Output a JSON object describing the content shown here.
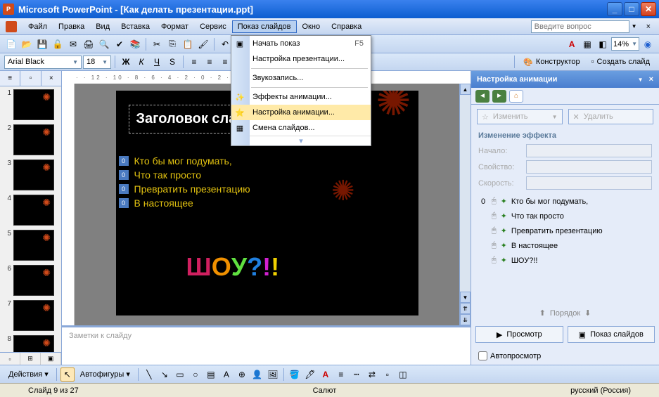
{
  "title": "Microsoft PowerPoint - [Как делать презентации.ppt]",
  "menu": {
    "file": "Файл",
    "edit": "Правка",
    "view": "Вид",
    "insert": "Вставка",
    "format": "Формат",
    "tools": "Сервис",
    "slideshow": "Показ слайдов",
    "window": "Окно",
    "help": "Справка"
  },
  "askPlaceholder": "Введите вопрос",
  "zoom": "14%",
  "font": {
    "name": "Arial Black",
    "size": "18"
  },
  "taskbtns": {
    "designer": "Конструктор",
    "newslide": "Создать слайд"
  },
  "dropdown": {
    "start": "Начать показ",
    "start_key": "F5",
    "setup": "Настройка презентации...",
    "record": "Звукозапись...",
    "effects": "Эффекты анимации...",
    "custom": "Настройка анимации...",
    "trans": "Смена слайдов..."
  },
  "slide": {
    "title": "Заголовок слайда",
    "bullets": [
      "Кто бы мог подумать,",
      "Что так просто",
      "Превратить презентацию",
      "В настоящее"
    ],
    "showLetters": [
      {
        "t": "Ш",
        "c": "#d02060"
      },
      {
        "t": "О",
        "c": "#f09000"
      },
      {
        "t": "У",
        "c": "#60e040"
      },
      {
        "t": "?",
        "c": "#2080e0"
      },
      {
        "t": "!",
        "c": "#d020d0"
      },
      {
        "t": "!",
        "c": "#f0d000"
      }
    ]
  },
  "notes": "Заметки к слайду",
  "taskpane": {
    "title": "Настройка анимации",
    "change": "Изменить",
    "remove": "Удалить",
    "section": "Изменение эффекта",
    "start_l": "Начало:",
    "prop_l": "Свойство:",
    "speed_l": "Скорость:",
    "effects": [
      {
        "n": "0",
        "t": "Кто бы мог подумать,"
      },
      {
        "n": "",
        "t": "Что так просто"
      },
      {
        "n": "",
        "t": "Превратить презентацию"
      },
      {
        "n": "",
        "t": "В настоящее"
      },
      {
        "n": "",
        "t": "ШОУ?!!"
      }
    ],
    "order": "Порядок",
    "preview": "Просмотр",
    "show": "Показ слайдов",
    "auto": "Автопросмотр"
  },
  "drawbar": {
    "actions": "Действия",
    "autoshapes": "Автофигуры"
  },
  "status": {
    "slide": "Слайд 9 из 27",
    "layout": "Салют",
    "lang": "русский (Россия)"
  }
}
